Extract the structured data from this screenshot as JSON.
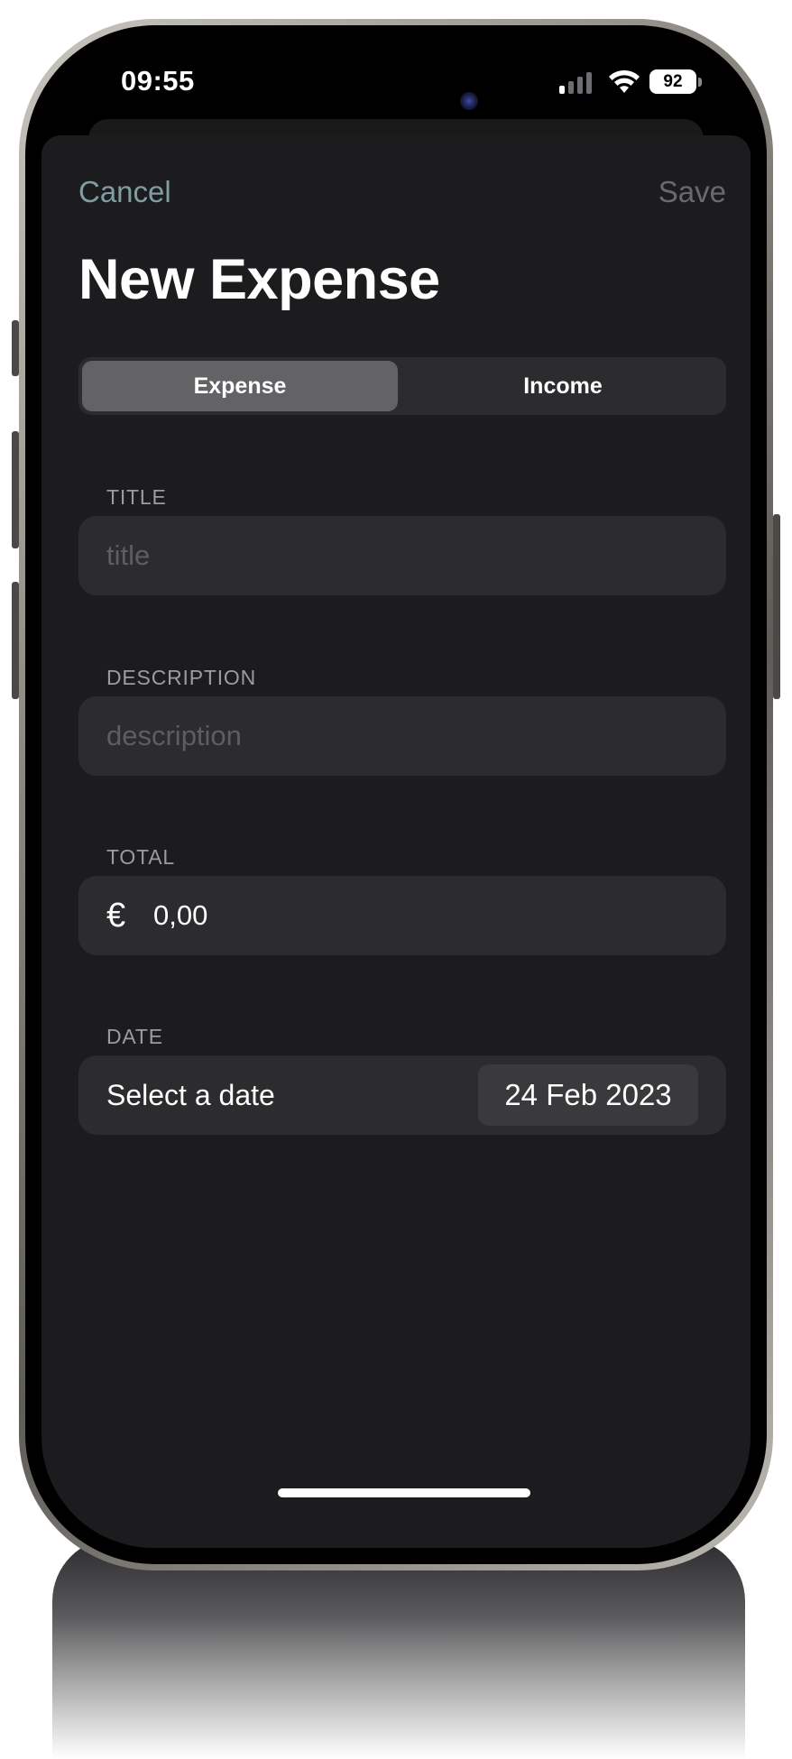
{
  "status_bar": {
    "time": "09:55",
    "battery": "92",
    "signal_icon": "cellular-signal-icon",
    "wifi_icon": "wifi-icon"
  },
  "nav": {
    "cancel_label": "Cancel",
    "save_label": "Save",
    "title": "New Expense"
  },
  "segment": {
    "options": [
      "Expense",
      "Income"
    ],
    "selected": "Expense"
  },
  "form": {
    "title_header": "TITLE",
    "title_placeholder": "title",
    "title_value": "",
    "description_header": "DESCRIPTION",
    "description_placeholder": "description",
    "description_value": "",
    "total_header": "TOTAL",
    "currency_symbol": "€",
    "total_value": "0,00",
    "date_header": "DATE",
    "date_label": "Select a date",
    "date_value": "24 Feb 2023"
  },
  "colors": {
    "accent": "#7f9ea3",
    "background": "#1c1c1e",
    "field_background": "#2c2c2e",
    "selected_segment": "#636366"
  }
}
